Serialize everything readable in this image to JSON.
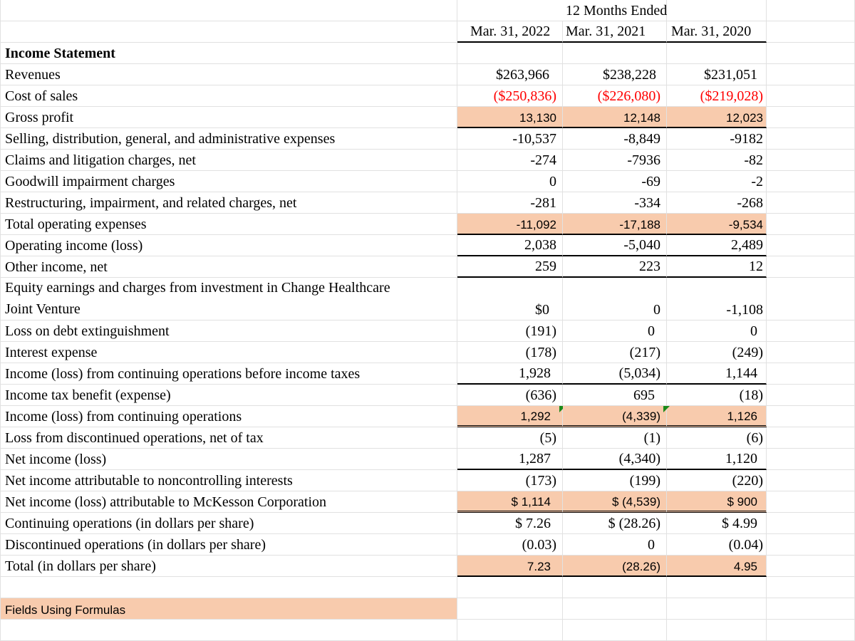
{
  "header": {
    "period_label": "12 Months Ended",
    "columns": [
      "Mar. 31, 2022",
      "Mar. 31, 2021",
      "Mar. 31, 2020"
    ]
  },
  "section_title": "Income Statement",
  "rows": [
    {
      "label": "Revenues",
      "values": [
        "$263,966",
        "$238,228",
        "$231,051"
      ]
    },
    {
      "label": "Cost of sales",
      "values": [
        "($250,836)",
        "($226,080)",
        "($219,028)"
      ]
    },
    {
      "label": "Gross profit",
      "values": [
        "13,130",
        "12,148",
        "12,023"
      ]
    },
    {
      "label": "Selling, distribution, general, and administrative expenses",
      "values": [
        "-10,537",
        "-8,849",
        "-9182"
      ]
    },
    {
      "label": "Claims and litigation charges, net",
      "values": [
        "-274",
        "-7936",
        "-82"
      ]
    },
    {
      "label": "Goodwill impairment charges",
      "values": [
        "0",
        "-69",
        "-2"
      ]
    },
    {
      "label": "Restructuring, impairment, and related charges, net",
      "values": [
        "-281",
        "-334",
        "-268"
      ]
    },
    {
      "label": "Total operating expenses",
      "values": [
        "-11,092",
        "-17,188",
        "-9,534"
      ]
    },
    {
      "label": "Operating income (loss)",
      "values": [
        "2,038",
        "-5,040",
        "2,489"
      ]
    },
    {
      "label": "Other income, net",
      "values": [
        "259",
        "223",
        "12"
      ]
    },
    {
      "label": "Equity earnings and charges from investment in Change Healthcare",
      "label2": "Joint Venture",
      "values": [
        "$0",
        "0",
        "-1,108"
      ]
    },
    {
      "label": "Loss on debt extinguishment",
      "values": [
        "(191)",
        "0",
        "0"
      ]
    },
    {
      "label": "Interest expense",
      "values": [
        "(178)",
        "(217)",
        "(249)"
      ]
    },
    {
      "label": "Income (loss) from continuing operations before income taxes",
      "values": [
        "1,928",
        "(5,034)",
        "1,144"
      ]
    },
    {
      "label": "Income tax benefit (expense)",
      "values": [
        "(636)",
        "695",
        "(18)"
      ]
    },
    {
      "label": "Income (loss) from continuing operations",
      "values": [
        "1,292",
        "(4,339)",
        "1,126"
      ]
    },
    {
      "label": "Loss from discontinued operations, net of tax",
      "values": [
        "(5)",
        "(1)",
        "(6)"
      ]
    },
    {
      "label": "Net income (loss)",
      "values": [
        "1,287",
        "(4,340)",
        "1,120"
      ]
    },
    {
      "label": "Net income attributable to noncontrolling interests",
      "values": [
        "(173)",
        "(199)",
        "(220)"
      ]
    },
    {
      "label": "Net income (loss) attributable to McKesson Corporation",
      "values": [
        "$ 1,114",
        "$ (4,539)",
        "$ 900"
      ]
    },
    {
      "label": "Continuing operations (in dollars per share)",
      "values": [
        "$ 7.26",
        "$ (28.26)",
        "$ 4.99"
      ]
    },
    {
      "label": "Discontinued operations (in dollars per share)",
      "values": [
        "(0.03)",
        "0",
        "(0.04)"
      ]
    },
    {
      "label": "Total (in dollars per share)",
      "values": [
        "7.23",
        "(28.26)",
        "4.95"
      ]
    }
  ],
  "legend": {
    "label": "Fields Using Formulas",
    "color": "#f8cbad"
  },
  "colors": {
    "formula_fill": "#f8cbad",
    "negative_red": "#ff0000",
    "error_triangle": "#1a8a1a"
  }
}
